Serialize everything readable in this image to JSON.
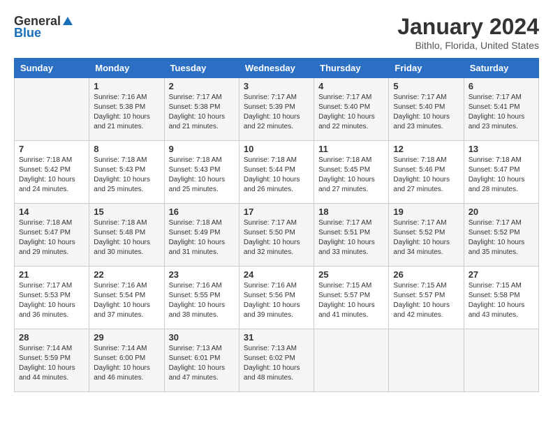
{
  "logo": {
    "general": "General",
    "blue": "Blue"
  },
  "title": "January 2024",
  "subtitle": "Bithlo, Florida, United States",
  "days_of_week": [
    "Sunday",
    "Monday",
    "Tuesday",
    "Wednesday",
    "Thursday",
    "Friday",
    "Saturday"
  ],
  "weeks": [
    [
      {
        "day": "",
        "info": ""
      },
      {
        "day": "1",
        "info": "Sunrise: 7:16 AM\nSunset: 5:38 PM\nDaylight: 10 hours\nand 21 minutes."
      },
      {
        "day": "2",
        "info": "Sunrise: 7:17 AM\nSunset: 5:38 PM\nDaylight: 10 hours\nand 21 minutes."
      },
      {
        "day": "3",
        "info": "Sunrise: 7:17 AM\nSunset: 5:39 PM\nDaylight: 10 hours\nand 22 minutes."
      },
      {
        "day": "4",
        "info": "Sunrise: 7:17 AM\nSunset: 5:40 PM\nDaylight: 10 hours\nand 22 minutes."
      },
      {
        "day": "5",
        "info": "Sunrise: 7:17 AM\nSunset: 5:40 PM\nDaylight: 10 hours\nand 23 minutes."
      },
      {
        "day": "6",
        "info": "Sunrise: 7:17 AM\nSunset: 5:41 PM\nDaylight: 10 hours\nand 23 minutes."
      }
    ],
    [
      {
        "day": "7",
        "info": "Sunrise: 7:18 AM\nSunset: 5:42 PM\nDaylight: 10 hours\nand 24 minutes."
      },
      {
        "day": "8",
        "info": "Sunrise: 7:18 AM\nSunset: 5:43 PM\nDaylight: 10 hours\nand 25 minutes."
      },
      {
        "day": "9",
        "info": "Sunrise: 7:18 AM\nSunset: 5:43 PM\nDaylight: 10 hours\nand 25 minutes."
      },
      {
        "day": "10",
        "info": "Sunrise: 7:18 AM\nSunset: 5:44 PM\nDaylight: 10 hours\nand 26 minutes."
      },
      {
        "day": "11",
        "info": "Sunrise: 7:18 AM\nSunset: 5:45 PM\nDaylight: 10 hours\nand 27 minutes."
      },
      {
        "day": "12",
        "info": "Sunrise: 7:18 AM\nSunset: 5:46 PM\nDaylight: 10 hours\nand 27 minutes."
      },
      {
        "day": "13",
        "info": "Sunrise: 7:18 AM\nSunset: 5:47 PM\nDaylight: 10 hours\nand 28 minutes."
      }
    ],
    [
      {
        "day": "14",
        "info": "Sunrise: 7:18 AM\nSunset: 5:47 PM\nDaylight: 10 hours\nand 29 minutes."
      },
      {
        "day": "15",
        "info": "Sunrise: 7:18 AM\nSunset: 5:48 PM\nDaylight: 10 hours\nand 30 minutes."
      },
      {
        "day": "16",
        "info": "Sunrise: 7:18 AM\nSunset: 5:49 PM\nDaylight: 10 hours\nand 31 minutes."
      },
      {
        "day": "17",
        "info": "Sunrise: 7:17 AM\nSunset: 5:50 PM\nDaylight: 10 hours\nand 32 minutes."
      },
      {
        "day": "18",
        "info": "Sunrise: 7:17 AM\nSunset: 5:51 PM\nDaylight: 10 hours\nand 33 minutes."
      },
      {
        "day": "19",
        "info": "Sunrise: 7:17 AM\nSunset: 5:52 PM\nDaylight: 10 hours\nand 34 minutes."
      },
      {
        "day": "20",
        "info": "Sunrise: 7:17 AM\nSunset: 5:52 PM\nDaylight: 10 hours\nand 35 minutes."
      }
    ],
    [
      {
        "day": "21",
        "info": "Sunrise: 7:17 AM\nSunset: 5:53 PM\nDaylight: 10 hours\nand 36 minutes."
      },
      {
        "day": "22",
        "info": "Sunrise: 7:16 AM\nSunset: 5:54 PM\nDaylight: 10 hours\nand 37 minutes."
      },
      {
        "day": "23",
        "info": "Sunrise: 7:16 AM\nSunset: 5:55 PM\nDaylight: 10 hours\nand 38 minutes."
      },
      {
        "day": "24",
        "info": "Sunrise: 7:16 AM\nSunset: 5:56 PM\nDaylight: 10 hours\nand 39 minutes."
      },
      {
        "day": "25",
        "info": "Sunrise: 7:15 AM\nSunset: 5:57 PM\nDaylight: 10 hours\nand 41 minutes."
      },
      {
        "day": "26",
        "info": "Sunrise: 7:15 AM\nSunset: 5:57 PM\nDaylight: 10 hours\nand 42 minutes."
      },
      {
        "day": "27",
        "info": "Sunrise: 7:15 AM\nSunset: 5:58 PM\nDaylight: 10 hours\nand 43 minutes."
      }
    ],
    [
      {
        "day": "28",
        "info": "Sunrise: 7:14 AM\nSunset: 5:59 PM\nDaylight: 10 hours\nand 44 minutes."
      },
      {
        "day": "29",
        "info": "Sunrise: 7:14 AM\nSunset: 6:00 PM\nDaylight: 10 hours\nand 46 minutes."
      },
      {
        "day": "30",
        "info": "Sunrise: 7:13 AM\nSunset: 6:01 PM\nDaylight: 10 hours\nand 47 minutes."
      },
      {
        "day": "31",
        "info": "Sunrise: 7:13 AM\nSunset: 6:02 PM\nDaylight: 10 hours\nand 48 minutes."
      },
      {
        "day": "",
        "info": ""
      },
      {
        "day": "",
        "info": ""
      },
      {
        "day": "",
        "info": ""
      }
    ]
  ]
}
